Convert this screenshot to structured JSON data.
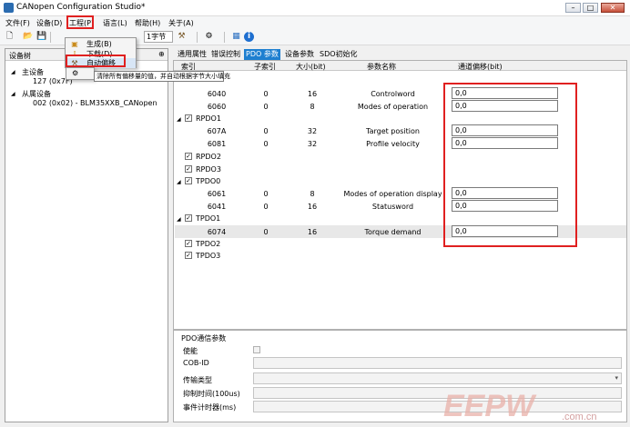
{
  "window": {
    "title": "CANopen Configuration Studio*",
    "btn_min": "–",
    "btn_max": "□",
    "btn_close": "✕"
  },
  "menu": {
    "file": "文件(F)",
    "device": "设备(D)",
    "project": "工程(P)",
    "language": "语言(L)",
    "help": "帮助(H)",
    "about": "关于(A)"
  },
  "toolbar": {
    "byte_select": "1字节"
  },
  "project_menu": {
    "items": [
      {
        "label": "生成(B)",
        "icon": "build-icon"
      },
      {
        "label": "下载(D)",
        "icon": "download-icon"
      },
      {
        "label": "自动偏移",
        "icon": "auto-offset-icon"
      }
    ],
    "tooltip": "清除所有偏移量的值，并自动根据字节大小填充"
  },
  "device_tree": {
    "header": "设备树",
    "pin": "⊕",
    "master_label": "主设备",
    "master_node": "127 (0x7F)",
    "slaves_label": "从属设备",
    "slave_node": "002 (0x02) - BLM35XXB_CANopen"
  },
  "tabs": [
    "通用属性",
    "错误控制",
    "PDO 参数",
    "设备参数",
    "SDO初始化"
  ],
  "columns": {
    "index": "索引",
    "subindex": "子索引",
    "size": "大小(bit)",
    "param_name": "参数名称",
    "offset": "通道偏移(bit)"
  },
  "pdo_rows": [
    {
      "index": "6040",
      "sub": "0",
      "size": "16",
      "name": "Controlword",
      "offset": "0,0"
    },
    {
      "index": "6060",
      "sub": "0",
      "size": "8",
      "name": "Modes of operation",
      "offset": "0,0"
    },
    {
      "group": "RPDO1"
    },
    {
      "index": "607A",
      "sub": "0",
      "size": "32",
      "name": "Target position",
      "offset": "0,0"
    },
    {
      "index": "6081",
      "sub": "0",
      "size": "32",
      "name": "Profile velocity",
      "offset": "0,0"
    },
    {
      "group": "RPDO2"
    },
    {
      "group": "RPDO3"
    },
    {
      "group": "TPDO0"
    },
    {
      "index": "6061",
      "sub": "0",
      "size": "8",
      "name": "Modes of operation display",
      "offset": "0,0"
    },
    {
      "index": "6041",
      "sub": "0",
      "size": "16",
      "name": "Statusword",
      "offset": "0,0"
    },
    {
      "group": "TPDO1"
    },
    {
      "index": "6074",
      "sub": "0",
      "size": "16",
      "name": "Torque demand",
      "offset": "0,0"
    },
    {
      "group": "TPDO2"
    },
    {
      "group": "TPDO3"
    }
  ],
  "pdo_comm": {
    "title": "PDO通信参数",
    "enable": "使能",
    "cob_id": "COB-ID",
    "transmission_type": "传输类型",
    "inhibit_time": "抑制时间(100us)",
    "event_timer": "事件计时器(ms)"
  },
  "watermark": {
    "brand": "EEPW",
    "url": ".com.cn"
  },
  "colors": {
    "accent": "#1e7fd0",
    "highlight": "#e02020"
  }
}
